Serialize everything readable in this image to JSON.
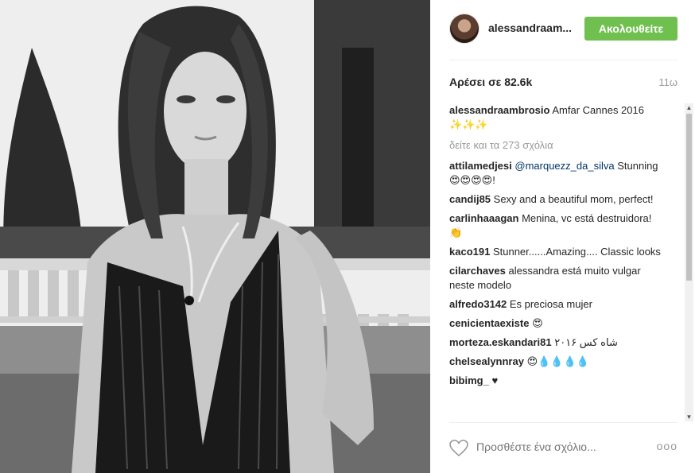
{
  "header": {
    "username": "alessandraam...",
    "follow_label": "Ακολουθείτε"
  },
  "stats": {
    "likes": "Αρέσει σε 82.6k",
    "time": "11ω"
  },
  "caption": {
    "user": "alessandraambrosio",
    "text": "Amfar Cannes 2016 ✨✨✨"
  },
  "view_all_comments": "δείτε και τα 273 σχόλια",
  "comments": [
    {
      "user": "attilamedjesi",
      "mention": "@marquezz_da_silva",
      "text": "Stunning😍😍😍😍!"
    },
    {
      "user": "candij85",
      "mention": "",
      "text": "Sexy and a beautiful mom, perfect!"
    },
    {
      "user": "carlinhaaagan",
      "mention": "",
      "text": "Menina, vc está destruidora! 👏"
    },
    {
      "user": "kaco191",
      "mention": "",
      "text": "Stunner......Amazing.... Classic looks"
    },
    {
      "user": "cilarchaves",
      "mention": "",
      "text": "alessandra está muito vulgar neste modelo"
    },
    {
      "user": "alfredo3142",
      "mention": "",
      "text": "Es preciosa mujer"
    },
    {
      "user": "cenicientaexiste",
      "mention": "",
      "text": "😍"
    },
    {
      "user": "morteza.eskandari81",
      "mention": "",
      "text": "شاه کس ۲۰۱۶"
    },
    {
      "user": "chelsealynnray",
      "mention": "",
      "text": "😍💧💧💧💧"
    },
    {
      "user": "bibimg_",
      "mention": "",
      "text": "♥"
    }
  ],
  "footer": {
    "add_comment_placeholder": "Προσθέστε ένα σχόλιο...",
    "more_label": "ooo"
  },
  "icons": {
    "heart": "heart-icon",
    "more": "more-options-icon",
    "scroll_up": "scroll-up-icon",
    "scroll_down": "scroll-down-icon"
  },
  "colors": {
    "follow_button": "#70c050",
    "mention": "#003569",
    "muted": "#999999"
  }
}
